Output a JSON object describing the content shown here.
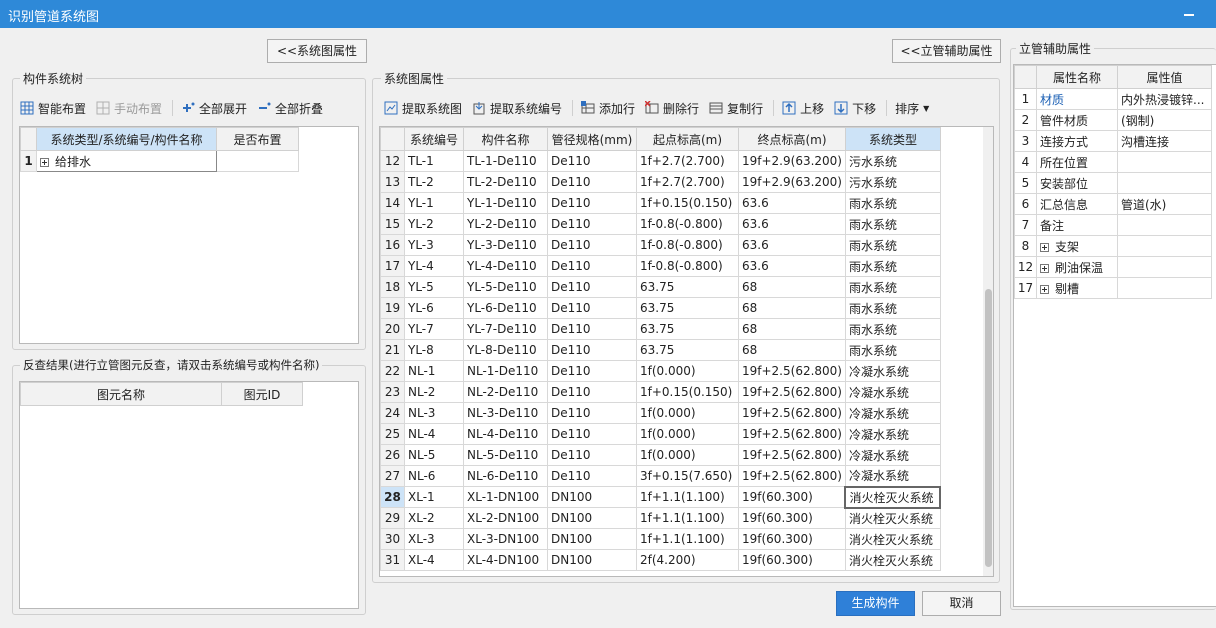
{
  "window": {
    "title": "识别管道系统图"
  },
  "buttons": {
    "system_props": "<<系统图属性",
    "riser_props": "<<立管辅助属性",
    "generate": "生成构件",
    "cancel": "取消"
  },
  "tree_group": {
    "title": "构件系统树",
    "toolbar": [
      "智能布置",
      "手动布置",
      "全部展开",
      "全部折叠"
    ],
    "headers": [
      "系统类型/系统编号/构件名称",
      "是否布置"
    ],
    "rows": [
      {
        "num": "1",
        "name": "给排水",
        "placed": ""
      }
    ]
  },
  "check_group": {
    "title": "反查结果(进行立管图元反查，请双击系统编号或构件名称)",
    "headers": [
      "图元名称",
      "图元ID"
    ]
  },
  "system_group": {
    "title": "系统图属性",
    "toolbar": [
      "提取系统图",
      "提取系统编号",
      "添加行",
      "删除行",
      "复制行",
      "上移",
      "下移",
      "排序"
    ],
    "headers": [
      "系统编号",
      "构件名称",
      "管径规格(mm)",
      "起点标高(m)",
      "终点标高(m)",
      "系统类型"
    ],
    "rows": [
      [
        "12",
        "TL-1",
        "TL-1-De110",
        "De110",
        "1f+2.7(2.700)",
        "19f+2.9(63.200)",
        "污水系统"
      ],
      [
        "13",
        "TL-2",
        "TL-2-De110",
        "De110",
        "1f+2.7(2.700)",
        "19f+2.9(63.200)",
        "污水系统"
      ],
      [
        "14",
        "YL-1",
        "YL-1-De110",
        "De110",
        "1f+0.15(0.150)",
        "63.6",
        "雨水系统"
      ],
      [
        "15",
        "YL-2",
        "YL-2-De110",
        "De110",
        "1f-0.8(-0.800)",
        "63.6",
        "雨水系统"
      ],
      [
        "16",
        "YL-3",
        "YL-3-De110",
        "De110",
        "1f-0.8(-0.800)",
        "63.6",
        "雨水系统"
      ],
      [
        "17",
        "YL-4",
        "YL-4-De110",
        "De110",
        "1f-0.8(-0.800)",
        "63.6",
        "雨水系统"
      ],
      [
        "18",
        "YL-5",
        "YL-5-De110",
        "De110",
        "63.75",
        "68",
        "雨水系统"
      ],
      [
        "19",
        "YL-6",
        "YL-6-De110",
        "De110",
        "63.75",
        "68",
        "雨水系统"
      ],
      [
        "20",
        "YL-7",
        "YL-7-De110",
        "De110",
        "63.75",
        "68",
        "雨水系统"
      ],
      [
        "21",
        "YL-8",
        "YL-8-De110",
        "De110",
        "63.75",
        "68",
        "雨水系统"
      ],
      [
        "22",
        "NL-1",
        "NL-1-De110",
        "De110",
        "1f(0.000)",
        "19f+2.5(62.800)",
        "冷凝水系统"
      ],
      [
        "23",
        "NL-2",
        "NL-2-De110",
        "De110",
        "1f+0.15(0.150)",
        "19f+2.5(62.800)",
        "冷凝水系统"
      ],
      [
        "24",
        "NL-3",
        "NL-3-De110",
        "De110",
        "1f(0.000)",
        "19f+2.5(62.800)",
        "冷凝水系统"
      ],
      [
        "25",
        "NL-4",
        "NL-4-De110",
        "De110",
        "1f(0.000)",
        "19f+2.5(62.800)",
        "冷凝水系统"
      ],
      [
        "26",
        "NL-5",
        "NL-5-De110",
        "De110",
        "1f(0.000)",
        "19f+2.5(62.800)",
        "冷凝水系统"
      ],
      [
        "27",
        "NL-6",
        "NL-6-De110",
        "De110",
        "3f+0.15(7.650)",
        "19f+2.5(62.800)",
        "冷凝水系统"
      ],
      [
        "28",
        "XL-1",
        "XL-1-DN100",
        "DN100",
        "1f+1.1(1.100)",
        "19f(60.300)",
        "消火栓灭火系统"
      ],
      [
        "29",
        "XL-2",
        "XL-2-DN100",
        "DN100",
        "1f+1.1(1.100)",
        "19f(60.300)",
        "消火栓灭火系统"
      ],
      [
        "30",
        "XL-3",
        "XL-3-DN100",
        "DN100",
        "1f+1.1(1.100)",
        "19f(60.300)",
        "消火栓灭火系统"
      ],
      [
        "31",
        "XL-4",
        "XL-4-DN100",
        "DN100",
        "2f(4.200)",
        "19f(60.300)",
        "消火栓灭火系统"
      ]
    ],
    "selected_row": "28"
  },
  "riser_group": {
    "title": "立管辅助属性",
    "headers": [
      "属性名称",
      "属性值"
    ],
    "rows": [
      {
        "num": "1",
        "name": "材质",
        "value": "内外热浸镀锌...",
        "blue": true,
        "expand": false
      },
      {
        "num": "2",
        "name": "管件材质",
        "value": "(钢制)",
        "blue": false,
        "expand": false
      },
      {
        "num": "3",
        "name": "连接方式",
        "value": "沟槽连接",
        "blue": false,
        "expand": false
      },
      {
        "num": "4",
        "name": "所在位置",
        "value": "",
        "blue": false,
        "expand": false
      },
      {
        "num": "5",
        "name": "安装部位",
        "value": "",
        "blue": false,
        "expand": false
      },
      {
        "num": "6",
        "name": "汇总信息",
        "value": "管道(水)",
        "blue": false,
        "expand": false
      },
      {
        "num": "7",
        "name": "备注",
        "value": "",
        "blue": false,
        "expand": false
      },
      {
        "num": "8",
        "name": "支架",
        "value": "",
        "blue": false,
        "expand": true
      },
      {
        "num": "12",
        "name": "刷油保温",
        "value": "",
        "blue": false,
        "expand": true
      },
      {
        "num": "17",
        "name": "剔槽",
        "value": "",
        "blue": false,
        "expand": true
      }
    ]
  },
  "colors": {
    "titlebar": "#2e89d8",
    "accent": "#2f80d8",
    "header_selected": "#cde3f7",
    "blue_text": "#1a5fb4"
  },
  "icons": [
    "grid-layout-icon",
    "manual-layout-icon",
    "expand-all-icon",
    "collapse-all-icon",
    "extract-diagram-icon",
    "extract-number-icon",
    "add-row-icon",
    "delete-row-icon",
    "copy-row-icon",
    "move-up-icon",
    "move-down-icon",
    "sort-dropdown-icon"
  ]
}
